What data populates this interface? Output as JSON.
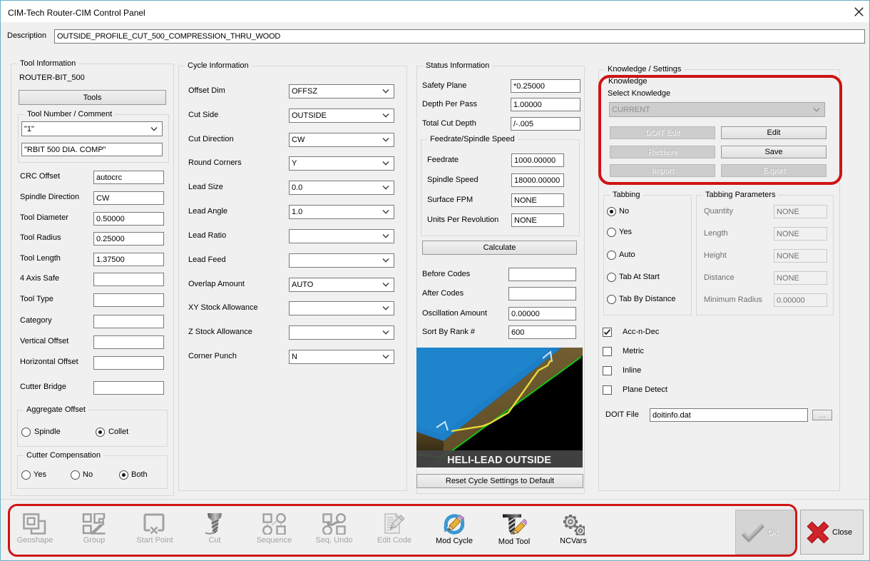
{
  "window": {
    "title": "CIM-Tech Router-CIM Control Panel"
  },
  "description": {
    "label": "Description",
    "value": "OUTSIDE_PROFILE_CUT_500_COMPRESSION_THRU_WOOD"
  },
  "tool_info": {
    "title": "Tool Information",
    "tool_name": "ROUTER-BIT_500",
    "tools_button": "Tools",
    "tool_number_group": {
      "title": "Tool Number / Comment",
      "number": "\"1\"",
      "comment": "\"RBIT 500 DIA. COMP\""
    },
    "fields": [
      {
        "label": "CRC Offset",
        "value": "autocrc"
      },
      {
        "label": "Spindle Direction",
        "value": "CW"
      },
      {
        "label": "Tool Diameter",
        "value": "0.50000"
      },
      {
        "label": "Tool Radius",
        "value": "0.25000"
      },
      {
        "label": "Tool Length",
        "value": "1.37500"
      },
      {
        "label": "4 Axis Safe",
        "value": ""
      },
      {
        "label": "Tool Type",
        "value": ""
      },
      {
        "label": "Category",
        "value": ""
      },
      {
        "label": "Vertical Offset",
        "value": ""
      },
      {
        "label": "Horizontal Offset",
        "value": ""
      },
      {
        "label": "Cutter Bridge",
        "value": ""
      }
    ],
    "aggregate_offset": {
      "title": "Aggregate Offset",
      "options": [
        {
          "label": "Spindle",
          "selected": false
        },
        {
          "label": "Collet",
          "selected": true
        }
      ]
    },
    "cutter_compensation": {
      "title": "Cutter Compensation",
      "options": [
        {
          "label": "Yes",
          "selected": false
        },
        {
          "label": "No",
          "selected": false
        },
        {
          "label": "Both",
          "selected": true
        }
      ]
    }
  },
  "cycle_info": {
    "title": "Cycle Information",
    "fields": [
      {
        "label": "Offset Dim",
        "value": "OFFSZ"
      },
      {
        "label": "Cut Side",
        "value": "OUTSIDE"
      },
      {
        "label": "Cut Direction",
        "value": "CW"
      },
      {
        "label": "Round Corners",
        "value": "Y"
      },
      {
        "label": "Lead Size",
        "value": "0.0"
      },
      {
        "label": "Lead Angle",
        "value": "1.0"
      },
      {
        "label": "Lead Ratio",
        "value": ""
      },
      {
        "label": "Lead Feed",
        "value": ""
      },
      {
        "label": "Overlap Amount",
        "value": "AUTO"
      },
      {
        "label": "XY Stock Allowance",
        "value": ""
      },
      {
        "label": "Z Stock Allowance",
        "value": ""
      },
      {
        "label": "Corner Punch",
        "value": "N"
      }
    ]
  },
  "status_info": {
    "title": "Status Information",
    "fields": [
      {
        "label": "Safety Plane",
        "value": "*0.25000"
      },
      {
        "label": "Depth Per Pass",
        "value": "1.00000"
      },
      {
        "label": "Total Cut Depth",
        "value": "/-.005"
      }
    ],
    "feedrate_group": {
      "title": "Feedrate/Spindle Speed",
      "fields": [
        {
          "label": "Feedrate",
          "value": "1000.00000"
        },
        {
          "label": "Spindle Speed",
          "value": "18000.00000"
        },
        {
          "label": "Surface FPM",
          "value": "NONE"
        },
        {
          "label": "Units Per Revolution",
          "value": "NONE"
        }
      ],
      "calculate_button": "Calculate"
    },
    "fields2": [
      {
        "label": "Before Codes",
        "value": ""
      },
      {
        "label": "After Codes",
        "value": ""
      },
      {
        "label": "Oscillation Amount",
        "value": "0.00000"
      },
      {
        "label": "Sort By Rank #",
        "value": "600"
      }
    ],
    "preview_caption": "HELI-LEAD OUTSIDE",
    "reset_button": "Reset Cycle Settings to Default"
  },
  "knowledge": {
    "title": "Knowledge / Settings",
    "knowledge_label": "Knowledge",
    "select_label": "Select Knowledge",
    "select_value": "CURRENT",
    "buttons": [
      {
        "label": "DOIT Edit",
        "disabled": true
      },
      {
        "label": "Edit",
        "disabled": false
      },
      {
        "label": "Retrieve",
        "disabled": true
      },
      {
        "label": "Save",
        "disabled": false
      },
      {
        "label": "Import",
        "disabled": true
      },
      {
        "label": "Export",
        "disabled": true
      }
    ],
    "tabbing": {
      "title": "Tabbing",
      "options": [
        {
          "label": "No",
          "selected": true
        },
        {
          "label": "Yes",
          "selected": false
        },
        {
          "label": "Auto",
          "selected": false
        },
        {
          "label": "Tab At Start",
          "selected": false
        },
        {
          "label": "Tab By Distance",
          "selected": false
        }
      ]
    },
    "tabbing_params": {
      "title": "Tabbing Parameters",
      "fields": [
        {
          "label": "Quantity",
          "value": "NONE"
        },
        {
          "label": "Length",
          "value": "NONE"
        },
        {
          "label": "Height",
          "value": "NONE"
        },
        {
          "label": "Distance",
          "value": "NONE"
        },
        {
          "label": "Minimum Radius",
          "value": "0.00000"
        }
      ]
    },
    "checkboxes": [
      {
        "label": "Acc-n-Dec",
        "checked": true
      },
      {
        "label": "Metric",
        "checked": false
      },
      {
        "label": "Inline",
        "checked": false
      },
      {
        "label": "Plane Detect",
        "checked": false
      }
    ],
    "doit_file": {
      "label": "DOIT File",
      "value": "doitinfo.dat",
      "browse": "..."
    }
  },
  "toolbar": {
    "items": [
      {
        "label": "Geoshape",
        "disabled": true
      },
      {
        "label": "Group",
        "disabled": true
      },
      {
        "label": "Start Point",
        "disabled": true
      },
      {
        "label": "Cut",
        "disabled": true
      },
      {
        "label": "Sequence",
        "disabled": true
      },
      {
        "label": "Seq. Undo",
        "disabled": true
      },
      {
        "label": "Edit Code",
        "disabled": true
      },
      {
        "label": "Mod Cycle",
        "disabled": false
      },
      {
        "label": "Mod Tool",
        "disabled": false
      },
      {
        "label": "NCVars",
        "disabled": false
      }
    ],
    "ok_label": "OK",
    "close_label": "Close"
  },
  "colors": {
    "annotation_red": "#d01313",
    "dialog_bg": "#f0f0f0",
    "titlebar_bg": "#ffffff",
    "window_border": "#68b2c6",
    "close_x_red": "#d2232a",
    "preview_blue": "#1c7ec6",
    "preview_brown": "#6d5a31",
    "preview_green": "#12c312",
    "preview_yellow": "#e8dc3a"
  }
}
